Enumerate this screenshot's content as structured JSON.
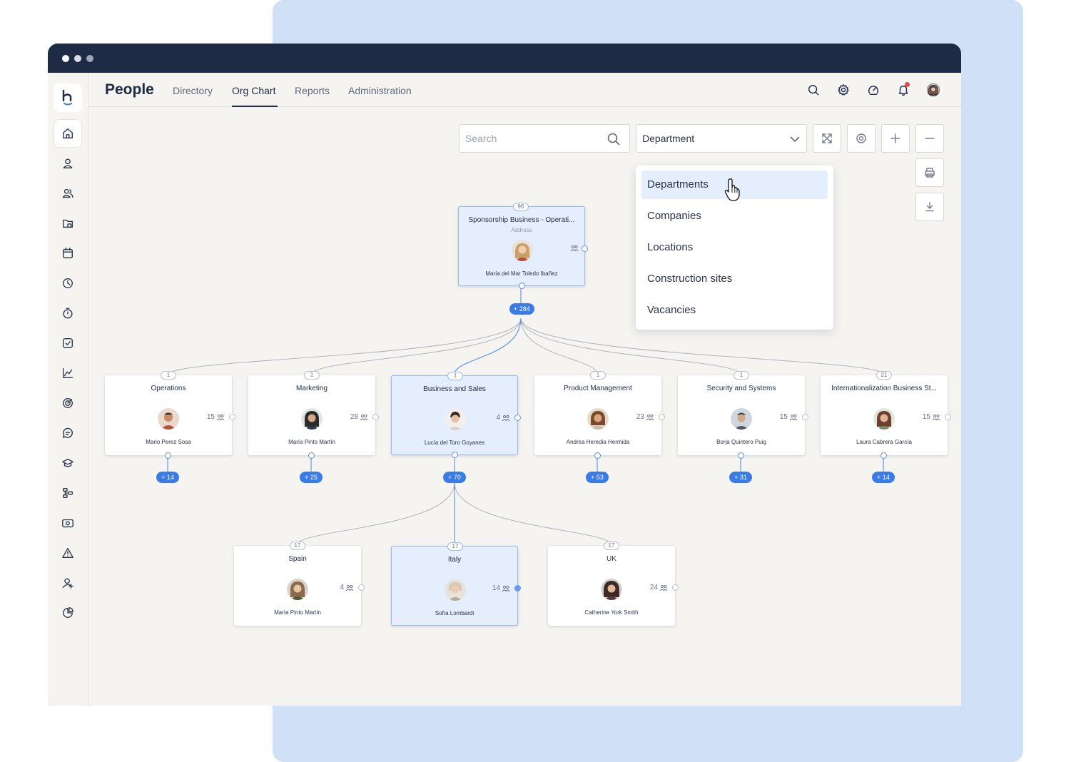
{
  "app": {
    "title": "People"
  },
  "nav": [
    {
      "label": "Directory"
    },
    {
      "label": "Org Chart"
    },
    {
      "label": "Reports"
    },
    {
      "label": "Administration"
    }
  ],
  "toolbar": {
    "search_placeholder": "Search",
    "grouping_value": "Department"
  },
  "dropdown": {
    "options": [
      "Departments",
      "Companies",
      "Locations",
      "Construction sites",
      "Vacancies"
    ],
    "selected": "Departments"
  },
  "root": {
    "badge": "96",
    "title": "Sponsorship Business - Operati...",
    "subtitle": "Address",
    "manager": "María del Mar Toledo Ibañez",
    "expander": "+ 284"
  },
  "departments": [
    {
      "badge": "1",
      "title": "Operations",
      "count": "15",
      "manager": "Mario Perez Sosa",
      "expander": "+ 14",
      "avatar_color": "#b5523b"
    },
    {
      "badge": "1",
      "title": "Marketing",
      "count": "28",
      "manager": "María Pinto Martín",
      "expander": "+ 25",
      "avatar_color": "#3a3a3a"
    },
    {
      "badge": "1",
      "title": "Business and Sales",
      "count": "4",
      "manager": "Lucía del Toro Goyanes",
      "expander": "+ 70",
      "avatar_color": "#caa58a"
    },
    {
      "badge": "1",
      "title": "Product Management",
      "count": "23",
      "manager": "Andrea Heredia Hermida",
      "expander": "+ 53",
      "avatar_color": "#7a4a2e"
    },
    {
      "badge": "1",
      "title": "Security and Systems",
      "count": "15",
      "manager": "Borja Quintero Puig",
      "expander": "+ 31",
      "avatar_color": "#4b5563"
    },
    {
      "badge": "21",
      "title": "Internationalization Business St...",
      "count": "15",
      "manager": "Laura Cabrera García",
      "expander": "+ 14",
      "avatar_color": "#6b4030"
    }
  ],
  "subunits": [
    {
      "badge": "17",
      "title": "Spain",
      "count": "4",
      "manager": "María Pinto Martín",
      "avatar_color": "#8a6a4a"
    },
    {
      "badge": "17",
      "title": "Italy",
      "count": "14",
      "manager": "Sofía Lombardi",
      "avatar_color": "#d8c8b8"
    },
    {
      "badge": "17",
      "title": "UK",
      "count": "24",
      "manager": "Catherine York Smith",
      "avatar_color": "#3b2a26"
    }
  ],
  "colors": {
    "accent": "#3b7be8",
    "titlebar": "#1f2a44",
    "highlight": "#e4eefc",
    "notification": "#e5484d"
  },
  "sidebar_icons": [
    "home-icon",
    "user-icon",
    "users-icon",
    "folder-icon",
    "calendar-icon",
    "clock-icon",
    "timer-icon",
    "checkbox-icon",
    "chart-icon",
    "target-icon",
    "chat-icon",
    "graduation-icon",
    "workflow-icon",
    "money-icon",
    "alert-icon",
    "user-add-icon",
    "pie-chart-icon"
  ]
}
